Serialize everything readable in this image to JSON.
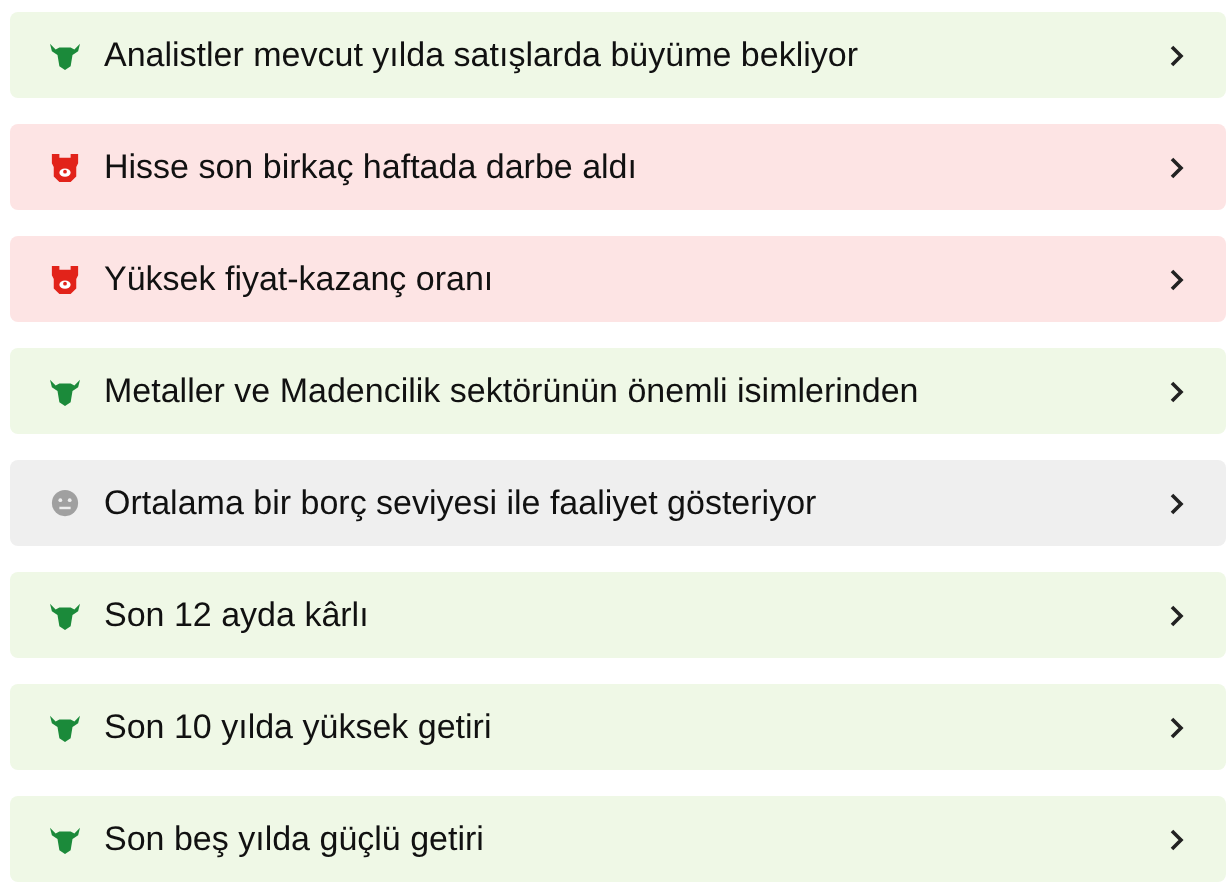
{
  "items": [
    {
      "kind": "bull",
      "text": "Analistler mevcut yılda satışlarda büyüme bekliyor"
    },
    {
      "kind": "bear",
      "text": "Hisse son birkaç haftada darbe aldı"
    },
    {
      "kind": "bear",
      "text": "Yüksek fiyat-kazanç oranı"
    },
    {
      "kind": "bull",
      "text": "Metaller ve Madencilik sektörünün önemli isimlerinden"
    },
    {
      "kind": "neutral",
      "text": "Ortalama bir borç seviyesi ile faaliyet gösteriyor"
    },
    {
      "kind": "bull",
      "text": "Son 12 ayda kârlı"
    },
    {
      "kind": "bull",
      "text": "Son 10 yılda yüksek getiri"
    },
    {
      "kind": "bull",
      "text": "Son beş yılda güçlü getiri"
    }
  ]
}
